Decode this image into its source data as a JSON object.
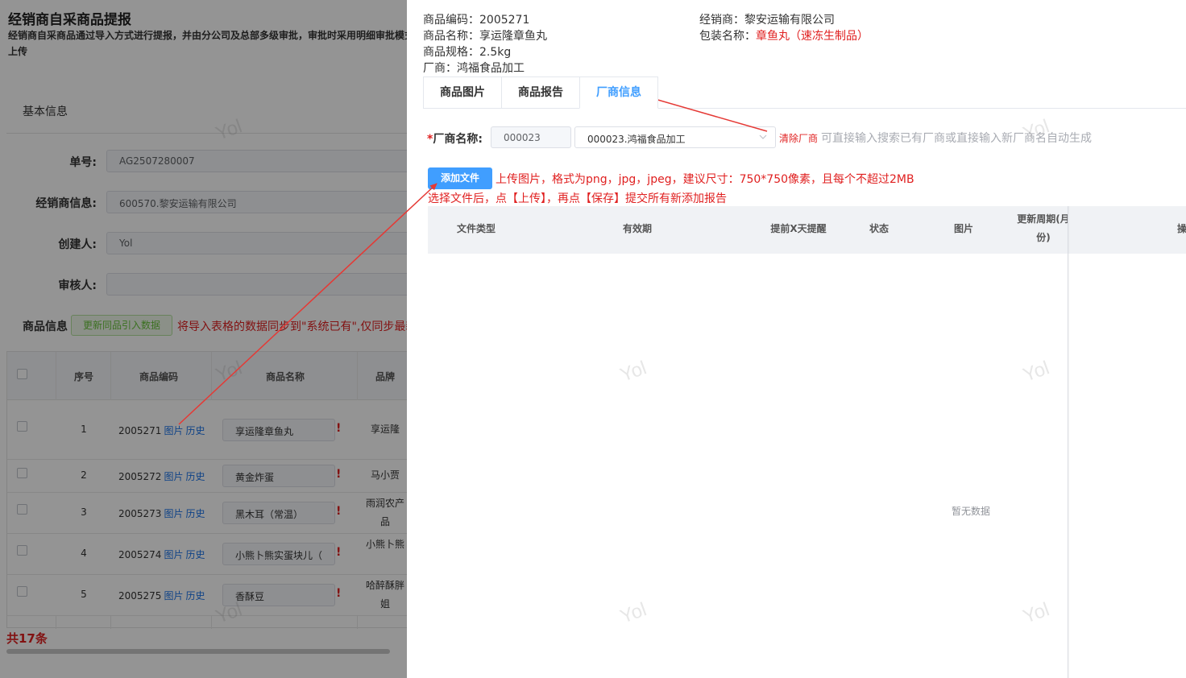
{
  "background": {
    "title": "经销商自采商品提报",
    "description": "经销商自采商品通过导入方式进行提报，并由分公司及总部多级审批，审批时采用明细审批模式",
    "description_tail": "上传",
    "section_title": "基本信息",
    "fields": {
      "order_no_label": "单号:",
      "order_no_value": "AG2507280007",
      "dealer_label": "经销商信息:",
      "dealer_value": "600570.黎安运输有限公司",
      "creator_label": "创建人:",
      "creator_value": "Yol",
      "reviewer_label": "审核人:",
      "reviewer_value": ""
    },
    "goods_label": "商品信息",
    "sync_button": "更新同品引入数据",
    "sync_note": "将导入表格的数据同步到\"系统已有\",仅同步最新",
    "table": {
      "headers": [
        "序号",
        "商品编码",
        "商品名称",
        "品牌"
      ],
      "rows": [
        {
          "seq": "1",
          "code": "2005271",
          "img": "图片",
          "hist": "历史",
          "name": "享运隆章鱼丸",
          "brand": "享运隆"
        },
        {
          "seq": "2",
          "code": "2005272",
          "img": "图片",
          "hist": "历史",
          "name": "黄金炸蛋",
          "brand": "马小贾"
        },
        {
          "seq": "3",
          "code": "2005273",
          "img": "图片",
          "hist": "历史",
          "name": "黑木耳（常温）",
          "brand": "雨润农产品"
        },
        {
          "seq": "4",
          "code": "2005274",
          "img": "图片",
          "hist": "历史",
          "name": "小熊卜熊实蛋块儿（",
          "brand": "小熊卜熊"
        },
        {
          "seq": "5",
          "code": "2005275",
          "img": "图片",
          "hist": "历史",
          "name": "香酥豆",
          "brand": "哈醉酥胖姐"
        }
      ],
      "excl": "!"
    },
    "total": "共17条"
  },
  "drawer": {
    "product_code": "商品编码：2005271",
    "product_name": "商品名称：享运隆章鱼丸",
    "product_spec": "商品规格：2.5kg",
    "manufacturer": "厂商：鸿福食品加工",
    "dealer": "经销商：黎安运输有限公司",
    "package_label": "包装名称：",
    "package_value": "章鱼丸（速冻生制品）",
    "tabs": [
      {
        "label": "商品图片",
        "active": false
      },
      {
        "label": "商品报告",
        "active": false
      },
      {
        "label": "厂商信息",
        "active": true
      }
    ],
    "vendor_label_star": "*",
    "vendor_label": "厂商名称:",
    "vendor_code": "000023",
    "vendor_select": "000023.鸿福食品加工",
    "clear_vendor": "清除厂商",
    "vendor_hint": "可直接输入搜索已有厂商或直接输入新厂商名自动生成",
    "add_file_button": "添加文件",
    "upload_note1": "上传图片，格式为png，jpg，jpeg，建议尺寸：750*750像素，且每个不超过2MB",
    "upload_note2": "选择文件后，点【上传】，再点【保存】提交所有新添加报告",
    "table_headers": {
      "file_type": "文件类型",
      "validity": "有效期",
      "remind": "提前X天提醒",
      "status": "状态",
      "image": "图片",
      "update_cycle_1": "更新周期(月",
      "update_cycle_2": "份)",
      "op": "操"
    },
    "empty_text": "暂无数据"
  },
  "watermark_text": "Yol",
  "colors": {
    "accent": "#409eff",
    "warning_red": "#e02020",
    "link_blue": "#1a73e8",
    "success_green": "#67c23a"
  }
}
